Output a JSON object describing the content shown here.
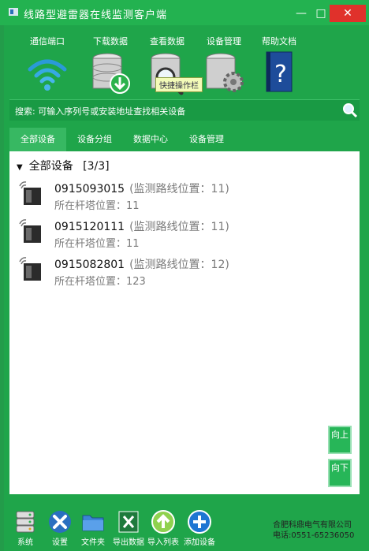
{
  "window": {
    "title": "线路型避雷器在线监测客户端",
    "minimize": "—",
    "maximize": "□",
    "close": "✕"
  },
  "toolbar": {
    "items": [
      {
        "label": "通信端口",
        "icon": "wifi-icon"
      },
      {
        "label": "下载数据",
        "icon": "database-download-icon"
      },
      {
        "label": "查看数据",
        "icon": "database-search-icon"
      },
      {
        "label": "设备管理",
        "icon": "database-gear-icon"
      },
      {
        "label": "帮助文档",
        "icon": "help-book-icon"
      }
    ],
    "tooltip": "快捷操作栏"
  },
  "search": {
    "label": "搜索: 可输入序列号或安装地址查找相关设备",
    "icon": "search-icon"
  },
  "tabs": [
    {
      "label": "全部设备",
      "active": true
    },
    {
      "label": "设备分组",
      "active": false
    },
    {
      "label": "数据中心",
      "active": false
    },
    {
      "label": "设备管理",
      "active": false
    }
  ],
  "tree": {
    "title": "全部设备",
    "count": "[3/3]",
    "devices": [
      {
        "id": "0915093015",
        "line_pos": "(监测路线位置：11)",
        "tower_pos": "所在杆塔位置：11"
      },
      {
        "id": "0915120111",
        "line_pos": "(监测路线位置：11)",
        "tower_pos": "所在杆塔位置：11"
      },
      {
        "id": "0915082801",
        "line_pos": "(监测路线位置：12)",
        "tower_pos": "所在杆塔位置：123"
      }
    ]
  },
  "nav": {
    "up": "向上",
    "down": "向下"
  },
  "bottom_bar": [
    {
      "label": "系统",
      "icon": "server-icon"
    },
    {
      "label": "设置",
      "icon": "tools-icon"
    },
    {
      "label": "文件夹",
      "icon": "folder-icon"
    },
    {
      "label": "导出数据",
      "icon": "excel-icon"
    },
    {
      "label": "导入列表",
      "icon": "upload-icon"
    },
    {
      "label": "添加设备",
      "icon": "add-icon"
    }
  ],
  "company": {
    "name": "合肥科鼎电气有限公司",
    "phone": "电话:0551-65236050"
  },
  "colors": {
    "background": "#1fa54a",
    "close": "#e0312b",
    "panel": "#ffffff"
  }
}
